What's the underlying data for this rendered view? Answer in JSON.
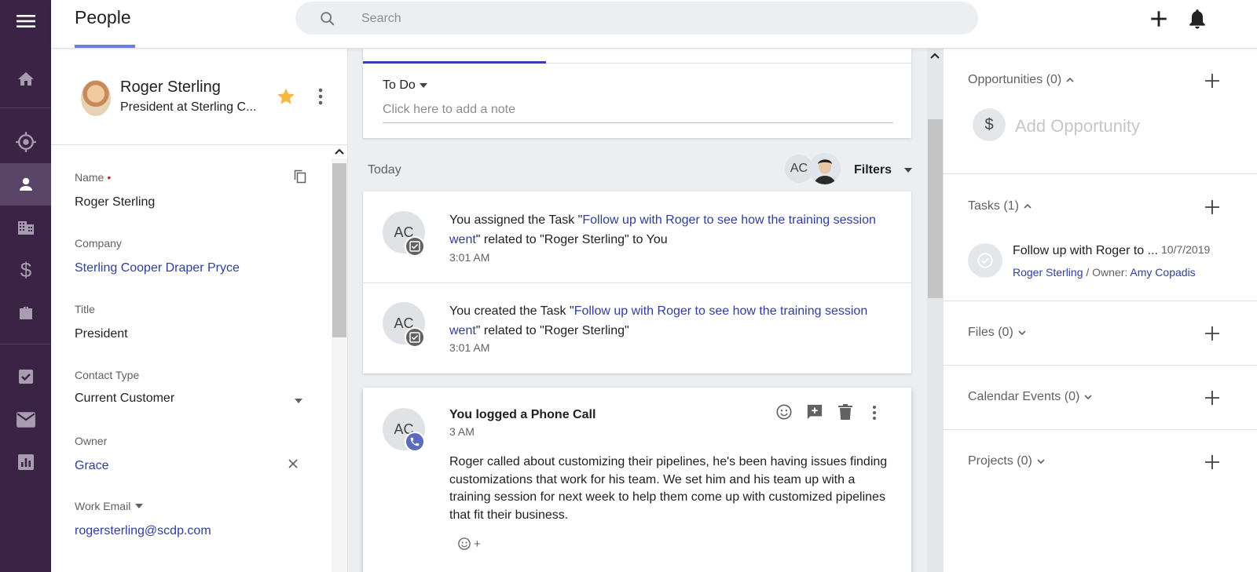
{
  "topbar": {
    "page_title": "People",
    "search_placeholder": "Search"
  },
  "rail": {
    "items": [
      "menu-icon",
      "home-icon",
      "target-icon",
      "person-icon",
      "building-icon",
      "dollar-icon",
      "briefcase-icon",
      "checkbox-icon",
      "mail-icon",
      "report-icon"
    ],
    "active": "person-icon"
  },
  "contact": {
    "name": "Roger Sterling",
    "subtitle": "President at Sterling C...",
    "fields": {
      "name_label": "Name",
      "name_required": "•",
      "name_value": "Roger Sterling",
      "company_label": "Company",
      "company_value": "Sterling Cooper Draper Pryce",
      "title_label": "Title",
      "title_value": "President",
      "contact_type_label": "Contact Type",
      "contact_type_value": "Current Customer",
      "owner_label": "Owner",
      "owner_value": "Grace",
      "work_email_label": "Work Email",
      "work_email_value": "rogersterling@scdp.com"
    }
  },
  "todo": {
    "label": "To Do",
    "placeholder": "Click here to add a note"
  },
  "feed": {
    "section_label": "Today",
    "filter_avatar": "AC",
    "filters_label": "Filters",
    "activities": [
      {
        "avatar": "AC",
        "prefix": "You assigned the Task \"",
        "link": "Follow up with Roger to see how the training session went",
        "suffix": "\" related to \"Roger Sterling\" to You",
        "time": "3:01 AM"
      },
      {
        "avatar": "AC",
        "prefix": "You created the Task \"",
        "link": "Follow up with Roger to see how the training session went",
        "suffix": "\" related to \"Roger Sterling\"",
        "time": "3:01 AM"
      }
    ],
    "call": {
      "avatar": "AC",
      "title": "You logged a Phone Call",
      "time": "3 AM",
      "body": "Roger called about customizing their pipelines, he's been having issues finding customizations that work for his team. We set him and his team up with a training session for next week to help them come up with customized pipelines that fit their business.",
      "react_plus": "+"
    }
  },
  "related": {
    "opportunities": {
      "title": "Opportunities (0)",
      "add_label": "Add Opportunity",
      "icon_glyph": "$"
    },
    "tasks": {
      "title": "Tasks (1)",
      "item": {
        "name": "Follow up with Roger to ...",
        "date": "10/7/2019",
        "related": "Roger Sterling",
        "owner_label": " / Owner: ",
        "owner": "Amy Copadis"
      }
    },
    "files": {
      "title": "Files (0)"
    },
    "calendar_events": {
      "title": "Calendar Events (0)"
    },
    "projects": {
      "title": "Projects (0)"
    }
  },
  "colors": {
    "rail": "#3b2346",
    "rail_active": "#5a4468",
    "link": "#2f3e9e",
    "tab_underline": "#6b7be8",
    "star": "#f5b942",
    "call_badge": "#5c6bc0"
  }
}
